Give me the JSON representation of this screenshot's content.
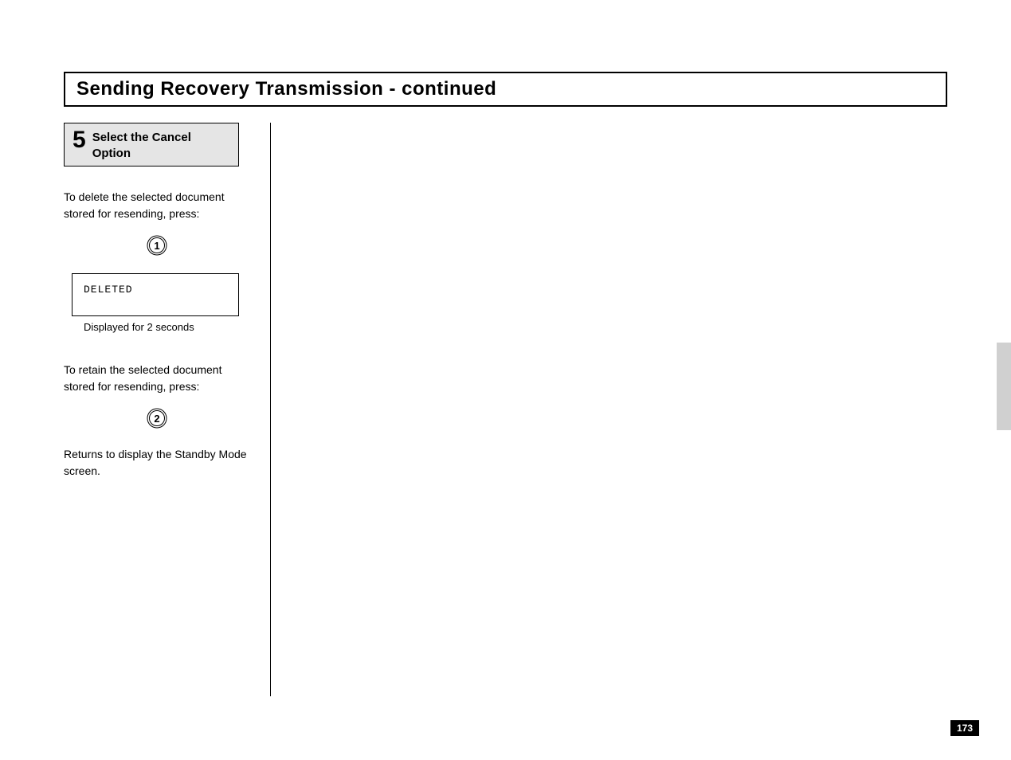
{
  "title": "Sending Recovery Transmission - continued",
  "step": {
    "number": "5",
    "title": "Select the Cancel Option"
  },
  "para1": "To delete the selected document stored for resending, press:",
  "key1": "1",
  "display": {
    "text": "DELETED",
    "caption": "Displayed for 2 seconds"
  },
  "para2": "To retain the selected document stored for resending, press:",
  "key2": "2",
  "para3": "Returns to display the Standby Mode screen.",
  "page_number": "173"
}
